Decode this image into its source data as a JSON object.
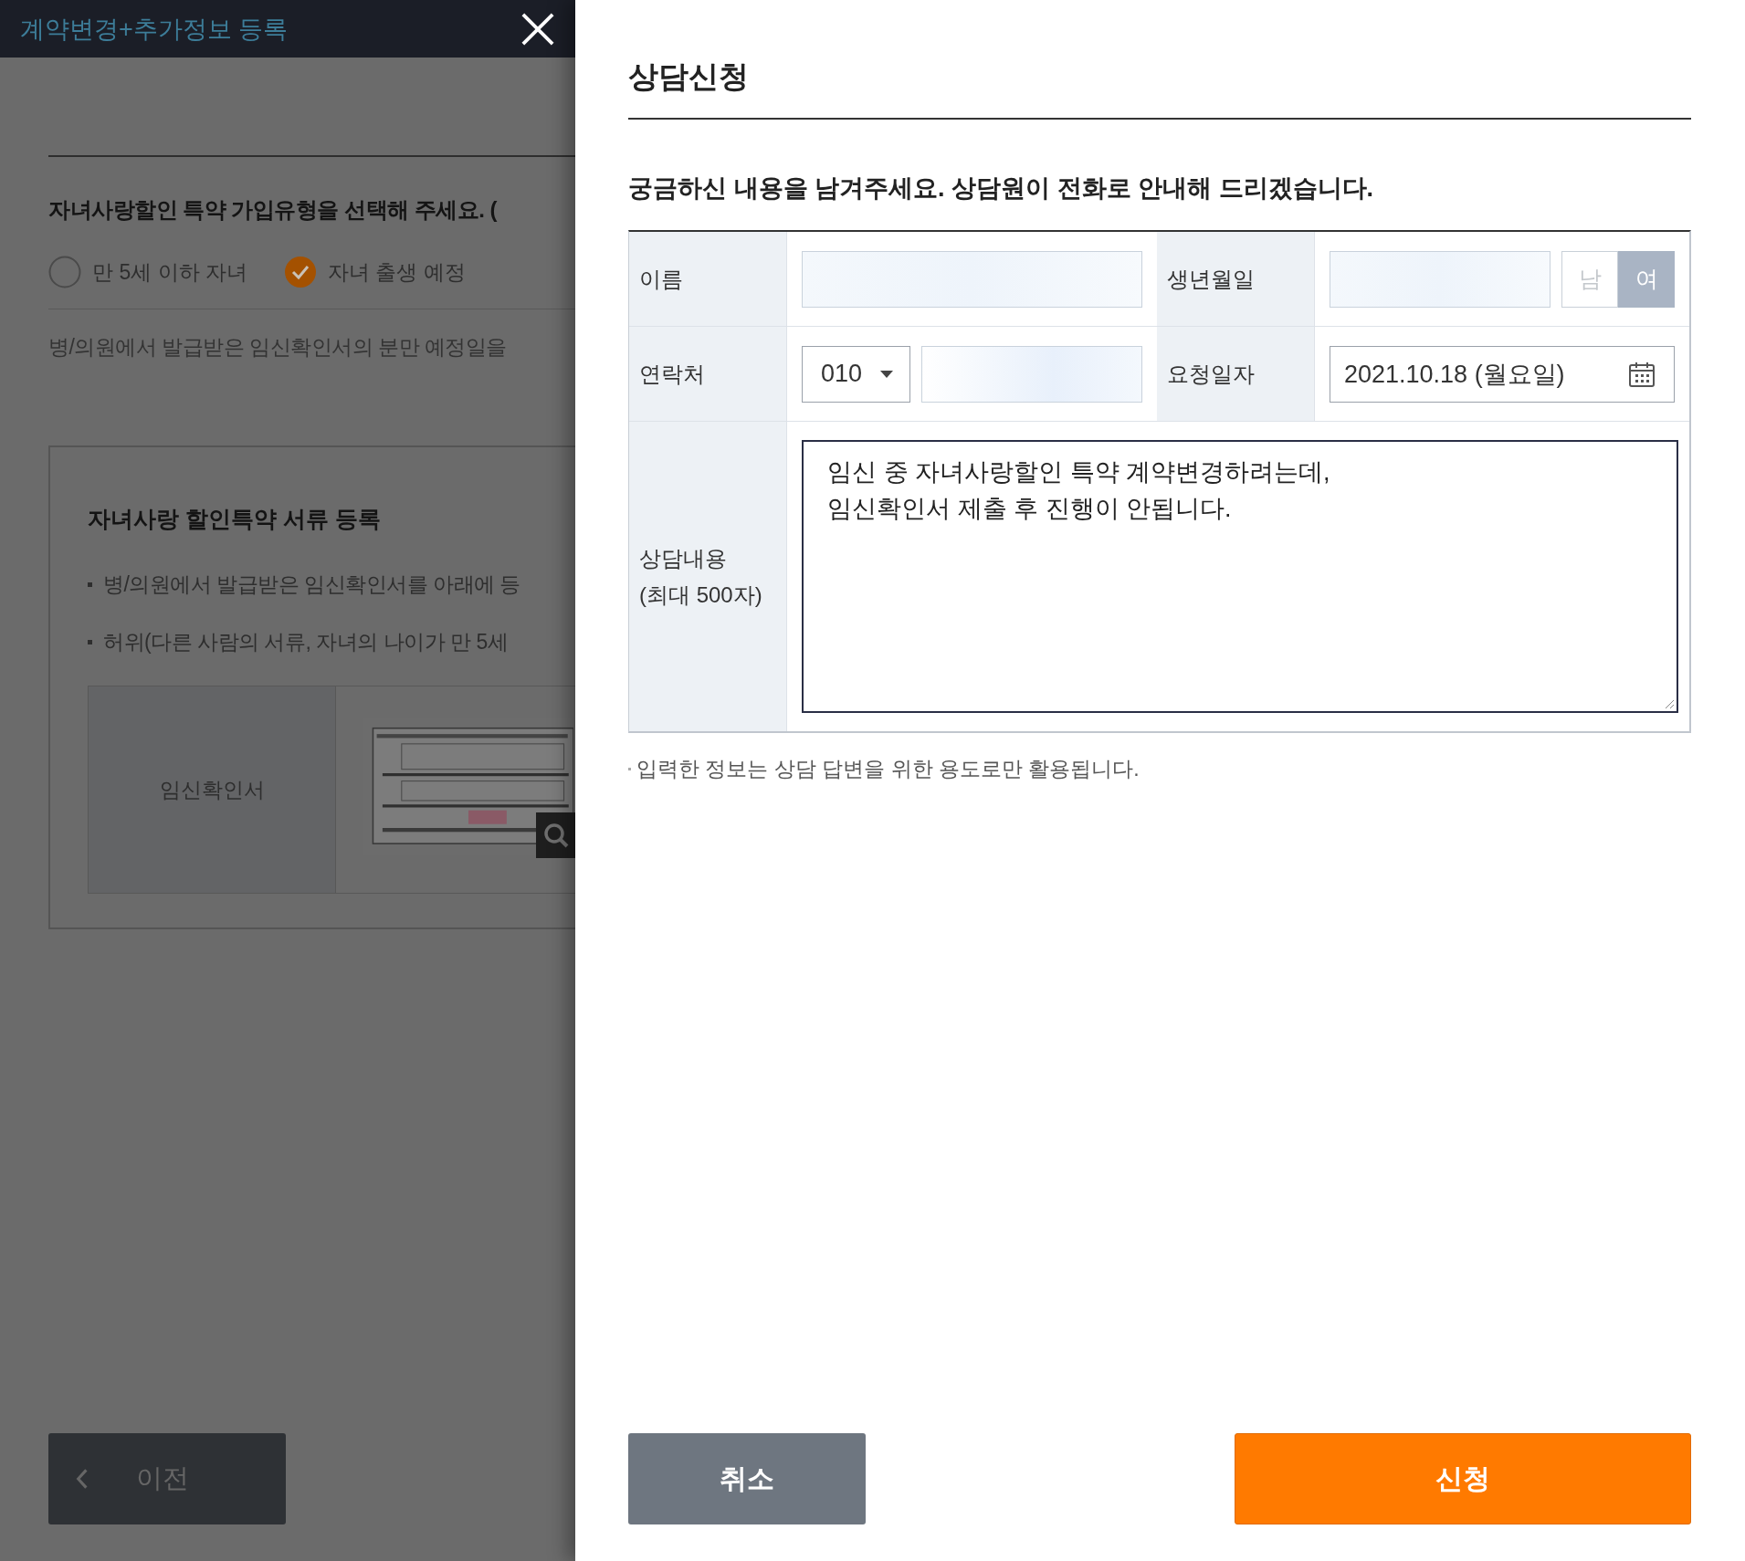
{
  "left_page": {
    "header_title": "계약변경+추가정보 등록",
    "question": "자녀사랑할인 특약 가입유형을 선택해 주세요. (",
    "options": [
      {
        "label": "만 5세 이하 자녀",
        "selected": false
      },
      {
        "label": "자녀 출생 예정",
        "selected": true
      }
    ],
    "instruction": "병/의원에서 발급받은 임신확인서의 분만 예정일을",
    "document_box": {
      "title": "자녀사랑 할인특약 서류 등록",
      "bullets": [
        "병/의원에서 발급받은 임신확인서를 아래에 등",
        "허위(다른 사람의 서류, 자녀의 나이가 만 5세"
      ],
      "document_label": "임신확인서"
    },
    "prev_button": "이전"
  },
  "dialog": {
    "title": "상담신청",
    "intro": "궁금하신 내용을 남겨주세요. 상담원이 전화로 안내해 드리겠습니다.",
    "form": {
      "name_label": "이름",
      "birth_label": "생년월일",
      "gender": [
        {
          "label": "남",
          "selected": false
        },
        {
          "label": "여",
          "selected": true
        }
      ],
      "phone_label": "연락처",
      "phone_prefix": "010",
      "date_label": "요청일자",
      "date_value": "2021.10.18 (월요일)",
      "content_label": "상담내용",
      "content_limit": "(최대 500자)",
      "content_lines": [
        "임신 중 자녀사랑할인 특약 계약변경하려는데,",
        "임신확인서 제출 후 진행이 안됩니다."
      ]
    },
    "note": "입력한 정보는 상담 답변을 위한 용도로만 활용됩니다.",
    "cancel_button": "취소",
    "submit_button": "신청"
  }
}
